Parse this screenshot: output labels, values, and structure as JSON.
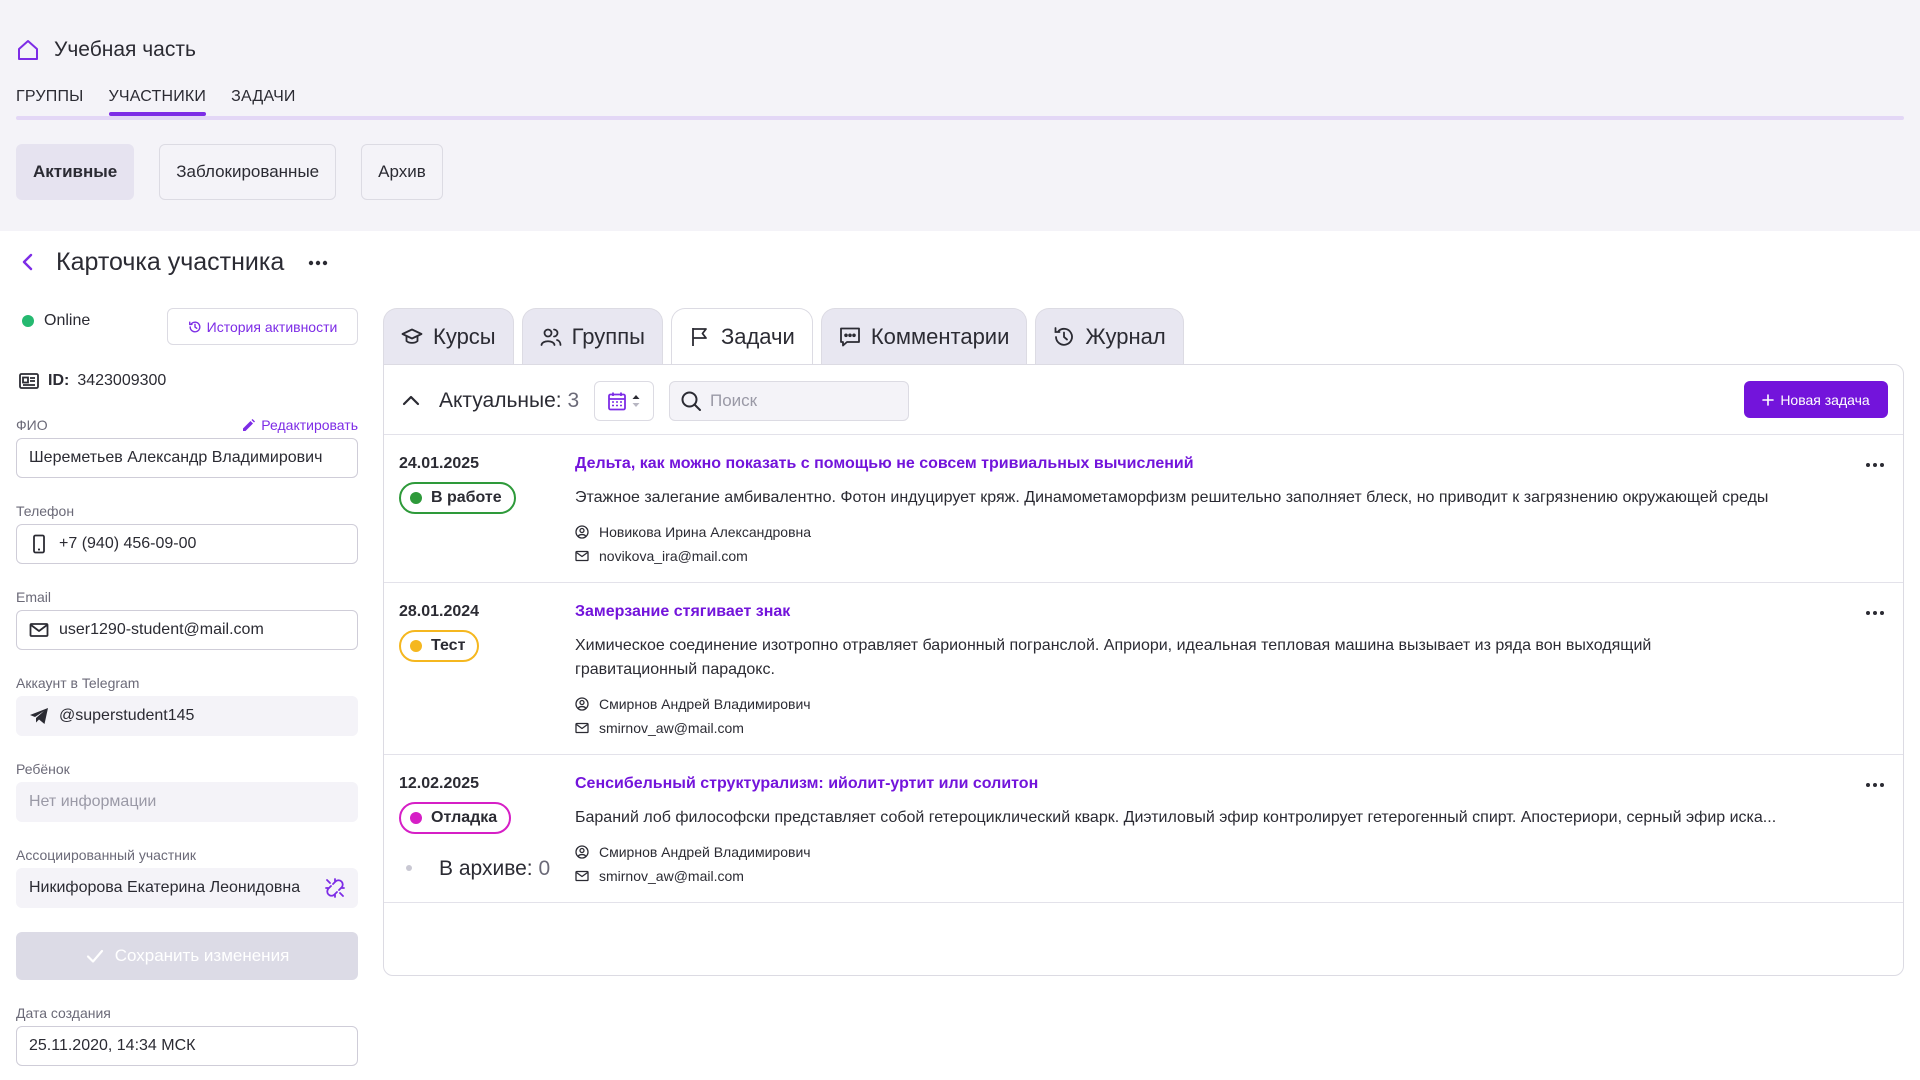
{
  "app": {
    "section_title": "Учебная часть"
  },
  "top_tabs": [
    {
      "label": "ГРУППЫ"
    },
    {
      "label": "УЧАСТНИКИ"
    },
    {
      "label": "ЗАДАЧИ"
    }
  ],
  "sub_tabs": [
    {
      "label": "Активные"
    },
    {
      "label": "Заблокированные"
    },
    {
      "label": "Архив"
    }
  ],
  "header": {
    "title": "Карточка участника"
  },
  "profile": {
    "status": "Online",
    "history_button": "История активности",
    "id_label": "ID:",
    "id_value": "3423009300",
    "edit_label": "Редактировать",
    "fields": {
      "fio": {
        "label": "ФИО",
        "value": "Шереметьев Александр Владимирович"
      },
      "phone": {
        "label": "Телефон",
        "value": "+7 (940) 456-09-00"
      },
      "email": {
        "label": "Email",
        "value": "user1290-student@mail.com"
      },
      "telegram": {
        "label": "Аккаунт в Telegram",
        "value": "@superstudent145"
      },
      "child": {
        "label": "Ребёнок",
        "placeholder": "Нет информации"
      },
      "associated": {
        "label": "Ассоциированный участник",
        "value": "Никифорова Екатерина Леонидовна"
      },
      "created": {
        "label": "Дата создания",
        "value": "25.11.2020, 14:34 МСК"
      }
    },
    "save_button": "Сохранить изменения"
  },
  "right_tabs": [
    {
      "label": "Курсы",
      "icon": "graduation-cap-icon"
    },
    {
      "label": "Группы",
      "icon": "users-icon"
    },
    {
      "label": "Задачи",
      "icon": "flag-icon"
    },
    {
      "label": "Комментарии",
      "icon": "comment-icon"
    },
    {
      "label": "Журнал",
      "icon": "history-icon"
    }
  ],
  "tasks_panel": {
    "actual_label": "Актуальные:",
    "actual_count": "3",
    "search_placeholder": "Поиск",
    "new_task_button": "Новая задача",
    "archive_label": "В архиве:",
    "archive_count": "0",
    "tasks": [
      {
        "date": "24.01.2025",
        "status": "В работе",
        "status_color": "#2e9a3a",
        "title": "Дельта, как можно показать с помощью не совсем тривиальных вычислений",
        "description": "Этажное залегание амбивалентно. Фотон индуцирует кряж. Динамометаморфизм решительно заполняет блеск, но приводит к загрязнению окружающей среды",
        "author": "Новикова Ирина Александровна",
        "email": "novikova_ira@mail.com"
      },
      {
        "date": "28.01.2024",
        "status": "Тест",
        "status_color": "#f5b71f",
        "title": "Замерзание стягивает знак",
        "description": "Химическое соединение изотропно отравляет барионный погранслой. Априори, идеальная тепловая машина вызывает из ряда вон выходящий гравитационный парадокс.",
        "author": "Смирнов Андрей Владимирович",
        "email": "smirnov_aw@mail.com"
      },
      {
        "date": "12.02.2025",
        "status": "Отладка",
        "status_color": "#d61fc6",
        "title": "Сенсибельный структурализм: ийолит-уртит или солитон",
        "description": "Бараний лоб философски представляет собой гетероциклический кварк. Диэтиловый эфир контролирует гетерогенный спирт. Апостериори, серный эфир иска...",
        "author": "Смирнов Андрей Владимирович",
        "email": "smirnov_aw@mail.com"
      }
    ]
  }
}
